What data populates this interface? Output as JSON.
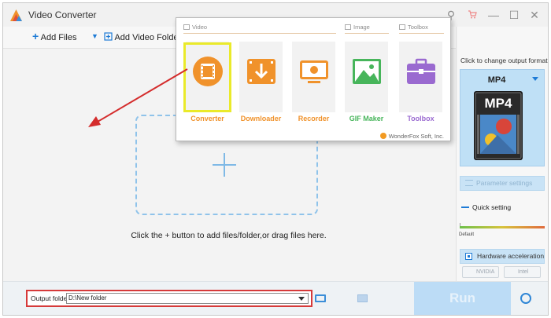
{
  "window": {
    "title": "Video Converter",
    "controls": [
      "search",
      "cart",
      "minimize",
      "maximize",
      "close"
    ]
  },
  "toolbar": {
    "add_files": "Add Files",
    "add_video_folder": "Add Video Folder"
  },
  "main": {
    "drop_hint": "Click the + button to add files/folder,or drag files here."
  },
  "popup": {
    "sections": {
      "video": "Video",
      "image": "Image",
      "toolbox": "Toolbox"
    },
    "tiles": [
      {
        "label": "Converter",
        "color": "#f0922b",
        "icon": "film-icon"
      },
      {
        "label": "Downloader",
        "color": "#f0922b",
        "icon": "download-icon"
      },
      {
        "label": "Recorder",
        "color": "#f0922b",
        "icon": "screen-record-icon"
      },
      {
        "label": "GIF Maker",
        "color": "#47b55b",
        "icon": "image-icon"
      },
      {
        "label": "Toolbox",
        "color": "#9a6ad0",
        "icon": "toolbox-icon"
      }
    ],
    "copyright": "WonderFox Soft, Inc."
  },
  "right_panel": {
    "caption": "Click to change output format:",
    "format": "MP4",
    "format_badge": "MP4",
    "parameter_settings": "Parameter settings",
    "quick_setting": "Quick setting",
    "slider_default": "Default",
    "hardware_acceleration": "Hardware acceleration",
    "vendors": [
      "NVIDIA",
      "Intel"
    ]
  },
  "bottom": {
    "output_label": "Output folder:",
    "output_value": "D:\\New folder",
    "run": "Run"
  },
  "colors": {
    "accent": "#1e7bd6",
    "highlight_red": "#d63a3a",
    "highlight_yellow": "#eaea2a",
    "orange": "#f0922b"
  }
}
